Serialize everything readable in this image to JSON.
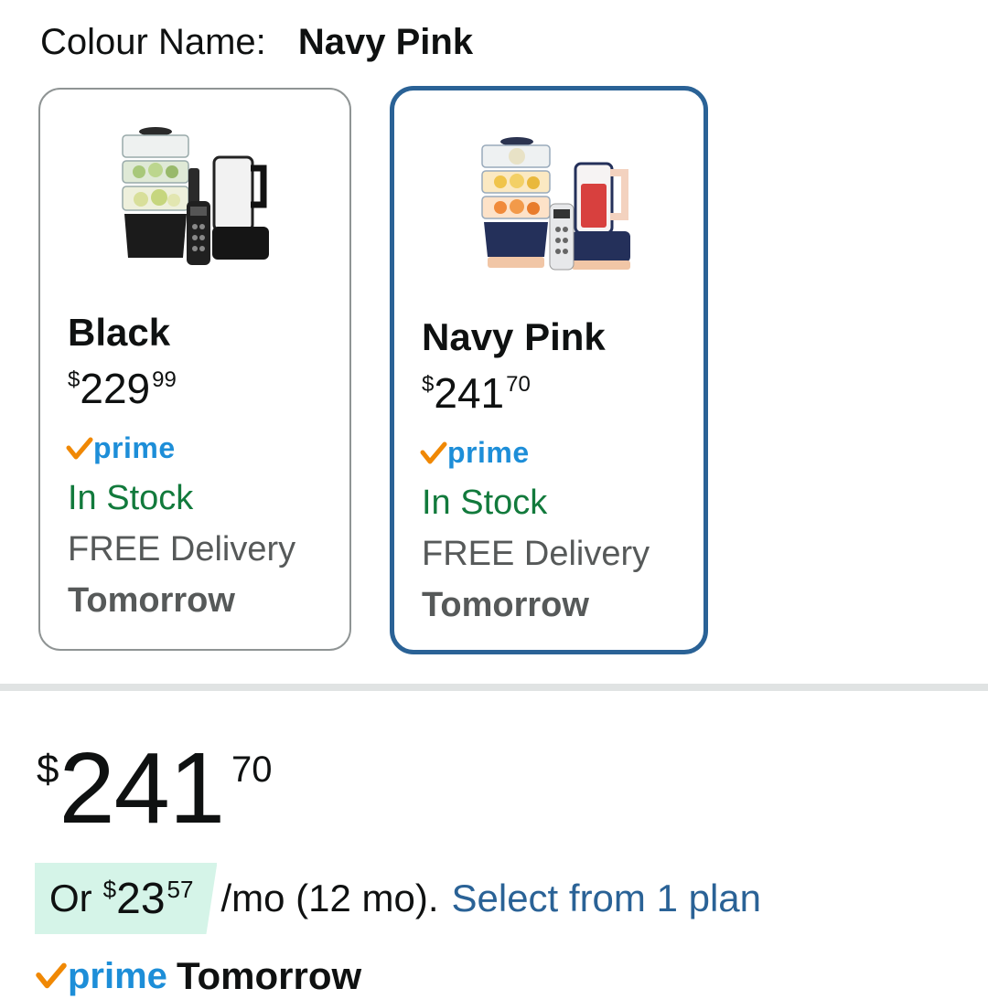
{
  "colour": {
    "label": "Colour Name:",
    "selected": "Navy Pink"
  },
  "options": [
    {
      "name": "Black",
      "price_symbol": "$",
      "price_whole": "229",
      "price_fraction": "99",
      "prime": "prime",
      "stock": "In Stock",
      "delivery": "FREE Delivery",
      "delivery_day": "Tomorrow",
      "image_icon": "black-food-processor-image",
      "selected": false
    },
    {
      "name": "Navy Pink",
      "price_symbol": "$",
      "price_whole": "241",
      "price_fraction": "70",
      "prime": "prime",
      "stock": "In Stock",
      "delivery": "FREE Delivery",
      "delivery_day": "Tomorrow",
      "image_icon": "navy-pink-food-processor-image",
      "selected": true
    }
  ],
  "price": {
    "symbol": "$",
    "whole": "241",
    "fraction": "70"
  },
  "installment": {
    "prefix": "Or",
    "symbol": "$",
    "whole": "23",
    "fraction": "57",
    "term": "/mo (12 mo).",
    "link": "Select from 1 plan"
  },
  "prime_delivery": {
    "prime": "prime",
    "day": "Tomorrow"
  },
  "colors": {
    "selected_border": "#2a6296",
    "stock_green": "#127a3c",
    "prime_blue": "#1d8ed8",
    "prime_check": "#f08804",
    "link": "#2a6296",
    "installment_bg": "#d5f4e8"
  }
}
